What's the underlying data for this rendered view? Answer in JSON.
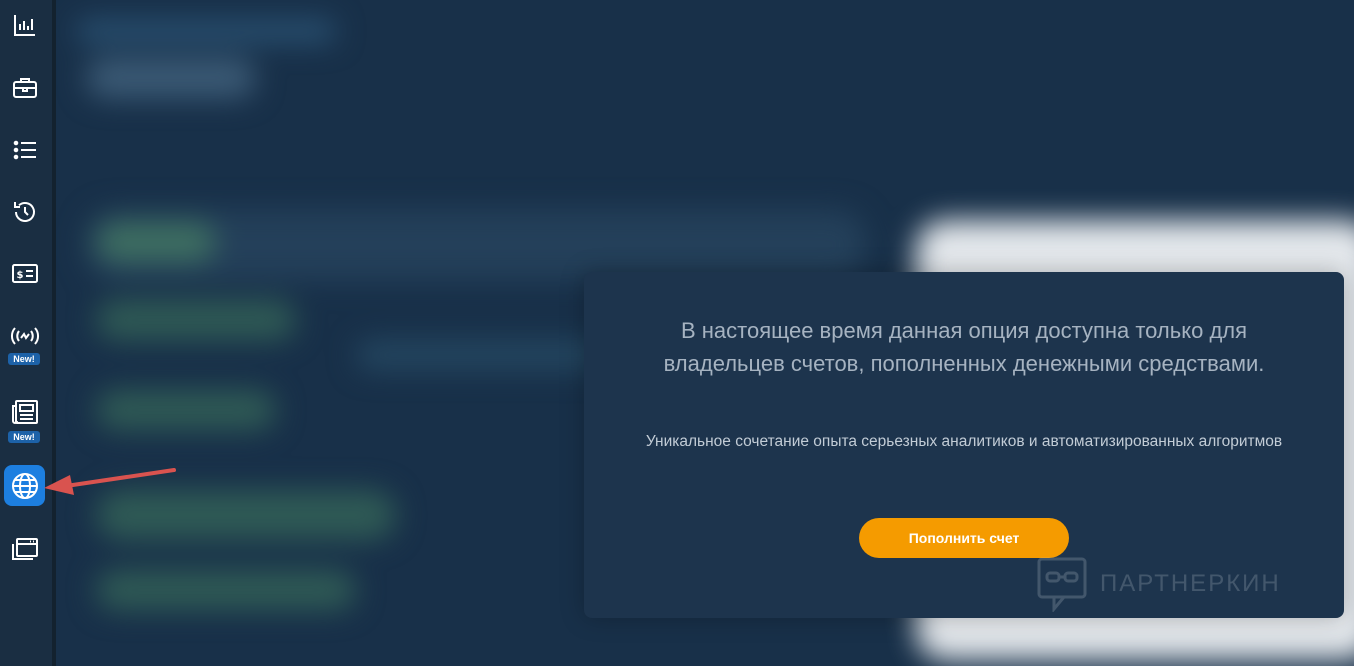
{
  "sidebar": {
    "items": [
      {
        "icon": "bar-chart-icon"
      },
      {
        "icon": "briefcase-icon"
      },
      {
        "icon": "list-icon"
      },
      {
        "icon": "history-icon"
      },
      {
        "icon": "dollar-card-icon"
      },
      {
        "icon": "broadcast-signal-icon",
        "badge": "New!"
      },
      {
        "icon": "newspaper-icon",
        "badge": "New!"
      },
      {
        "icon": "globe-icon",
        "active": true
      },
      {
        "icon": "browser-window-icon"
      }
    ]
  },
  "modal": {
    "title": "В настоящее время данная опция доступна только для владельцев счетов, пополненных денежными средствами.",
    "subtitle": "Уникальное сочетание опыта серьезных аналитиков и автоматизированных алгоритмов",
    "button_label": "Пополнить счет"
  },
  "watermark": {
    "text": "ПАРТНЕРКИН"
  },
  "colors": {
    "accent": "#1d7fe0",
    "button": "#f59b00",
    "modal_bg": "#1d344d",
    "sidebar_bg": "#1a2e42",
    "annotation_arrow": "#d9534f"
  }
}
